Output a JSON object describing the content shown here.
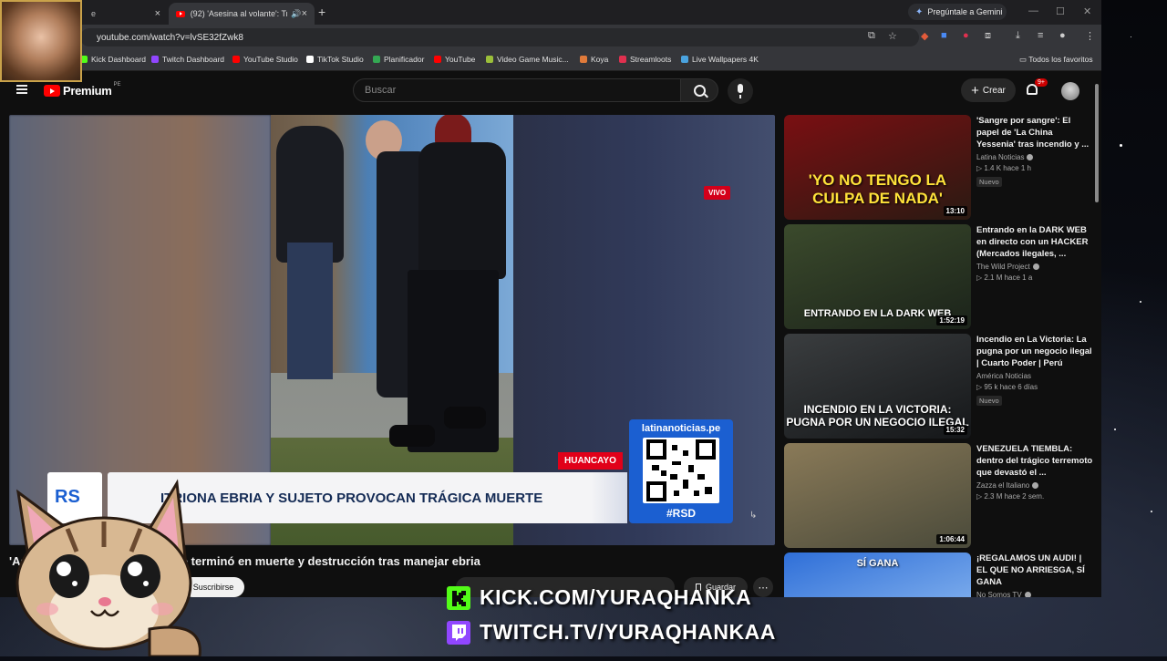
{
  "browser": {
    "tabs": [
      {
        "label": "e",
        "active": false
      },
      {
        "label": "(92) 'Asesina al volante': Trá",
        "active": true
      }
    ],
    "gemini_label": "Pregúntale a Gemini",
    "url": "youtube.com/watch?v=lvSE32fZwk8",
    "bookmarks": [
      {
        "label": "Kick Dashboard",
        "icon": "kick-icon",
        "color": "#53fc18"
      },
      {
        "label": "Twitch Dashboard",
        "icon": "twitch-icon",
        "color": "#9146ff"
      },
      {
        "label": "YouTube Studio",
        "icon": "youtube-icon",
        "color": "#ff0000"
      },
      {
        "label": "TikTok Studio",
        "icon": "tiktok-icon",
        "color": "#ffffff"
      },
      {
        "label": "Planificador",
        "icon": "planner-icon",
        "color": "#34a853"
      },
      {
        "label": "YouTube",
        "icon": "youtube-icon",
        "color": "#ff0000"
      },
      {
        "label": "Video Game Music...",
        "icon": "music-icon",
        "color": "#9bbf3a"
      },
      {
        "label": "Koya",
        "icon": "koya-icon",
        "color": "#e07a3a"
      },
      {
        "label": "Streamloots",
        "icon": "streamloots-icon",
        "color": "#e0304f"
      },
      {
        "label": "Live Wallpapers 4K",
        "icon": "globe-icon",
        "color": "#4aa3df"
      }
    ],
    "all_bookmarks_label": "Todos los favoritos"
  },
  "youtube": {
    "logo_text": "Premium",
    "region": "PE",
    "search_placeholder": "Buscar",
    "create_label": "Crear",
    "notifications": "9+"
  },
  "player": {
    "live_badge": "VIVO",
    "location_tag": "HUANCAYO",
    "lower_third": "ITRIONA EBRIA Y SUJETO PROVOCAN TRÁGICA MUERTE",
    "qr_site": "latinanoticias.pe",
    "qr_tag": "#RSD",
    "channel_logo": "RS"
  },
  "video": {
    "title": "'As",
    "title_rest": "pello terminó en muerte y destrucción tras manejar ebria",
    "subscribe_label": "Suscribirse",
    "save_label": "Guardar"
  },
  "recommendations": [
    {
      "title": "'Sangre por sangre': El papel de 'La China Yessenia' tras incendio y ...",
      "channel": "Latina Noticias",
      "verified": true,
      "stats": "1.4 K  hace 1 h",
      "badge": "Nuevo",
      "duration": "13:10",
      "thumb_text": "'YO NO TENGO LA CULPA DE NADA'",
      "thumb_colors": [
        "#7a0f12",
        "#2a1a12"
      ]
    },
    {
      "title": "Entrando en la DARK WEB en directo con un HACKER (Mercados ilegales, ...",
      "channel": "The Wild Project",
      "verified": true,
      "stats": "2.1 M  hace 1 a",
      "badge": "",
      "duration": "1:52:19",
      "thumb_text": "ENTRANDO EN LA DARK WEB",
      "thumb_colors": [
        "#3b4a2c",
        "#1b231a"
      ]
    },
    {
      "title": "Incendio en La Victoria: La pugna por un negocio ilegal | Cuarto Poder | Perú",
      "channel": "América Noticias",
      "verified": false,
      "stats": "95 k  hace 6 días",
      "badge": "Nuevo",
      "duration": "15:32",
      "thumb_text": "INCENDIO EN LA VICTORIA: PUGNA POR UN NEGOCIO ILEGAL",
      "thumb_colors": [
        "#3a3d3f",
        "#151719"
      ]
    },
    {
      "title": "VENEZUELA TIEMBLA: dentro del trágico terremoto que devastó el ...",
      "channel": "Zazza el Italiano",
      "verified": true,
      "stats": "2.3 M  hace 2 sem.",
      "badge": "",
      "duration": "1:06:44",
      "thumb_text": "",
      "thumb_colors": [
        "#8a7a58",
        "#4a4a3a"
      ]
    },
    {
      "title": "¡REGALAMOS UN AUDI! | EL QUE NO ARRIESGA, SÍ GANA",
      "channel": "No Somos TV",
      "verified": true,
      "stats": "",
      "badge": "",
      "duration": "",
      "thumb_text": "SÍ GANA",
      "thumb_colors": [
        "#2f6fd8",
        "#9ec7f5"
      ]
    }
  ],
  "overlay": {
    "kick_url": "KICK.COM/YURAQHANKA",
    "twitch_url": "TWITCH.TV/YURAQHANKAA"
  }
}
